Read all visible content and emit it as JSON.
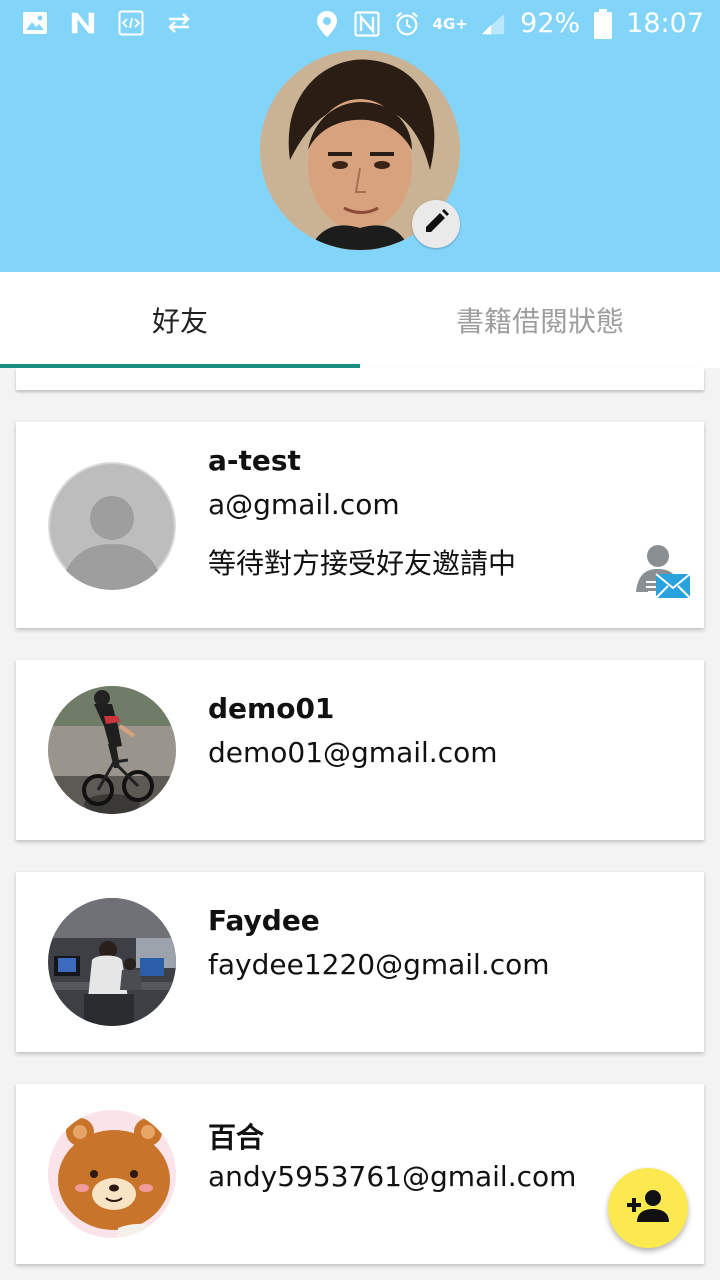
{
  "status_bar": {
    "battery": "92%",
    "time": "18:07",
    "network": "4G+",
    "icons_left": [
      "image-icon",
      "n-notification-icon",
      "code-icon",
      "sync-icon"
    ],
    "icons_right": [
      "location-icon",
      "nfc-icon",
      "alarm-icon",
      "signal-icon",
      "battery-icon"
    ]
  },
  "header": {
    "avatar": "profile-photo",
    "edit_icon": "pencil-icon"
  },
  "tabs": [
    {
      "label": "好友",
      "active": true
    },
    {
      "label": "書籍借閱狀態",
      "active": false
    }
  ],
  "friends": [
    {
      "name": "a-test",
      "email": "a@gmail.com",
      "status": "等待對方接受好友邀請中",
      "avatar": "default-person",
      "pending": true
    },
    {
      "name": "demo01",
      "email": "demo01@gmail.com",
      "avatar": "cyclist-photo"
    },
    {
      "name": "Faydee",
      "email": "faydee1220@gmail.com",
      "avatar": "office-photo"
    },
    {
      "name": "百合",
      "email": "andy5953761@gmail.com",
      "avatar": "bear-cartoon"
    }
  ],
  "fab": {
    "icon": "add-person-icon"
  },
  "colors": {
    "header": "#82d4f9",
    "tab_indicator": "#1a8f82",
    "fab": "#fbe94f"
  }
}
